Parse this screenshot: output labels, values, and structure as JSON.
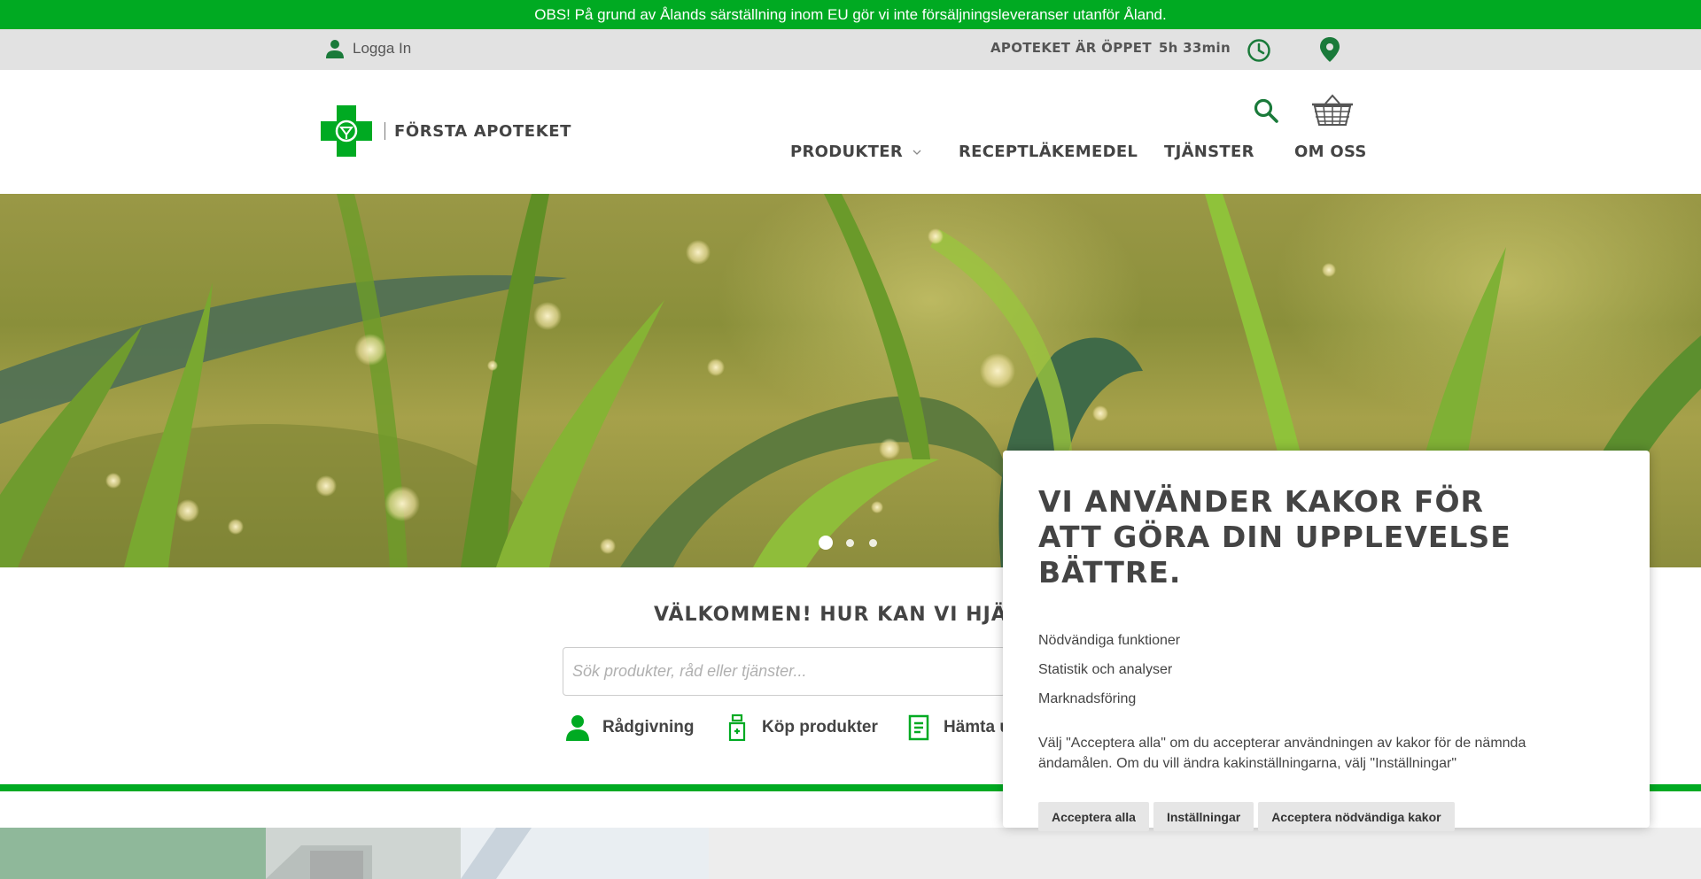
{
  "notice": {
    "text": "OBS! På grund av Ålands särställning inom EU gör vi inte försäljningsleveranser utanför Åland."
  },
  "topbar": {
    "login_label": "Logga In",
    "status_label": "APOTEKET ÄR ÖPPET",
    "status_time": "5h 33min",
    "icons": [
      "user-icon",
      "clock-icon",
      "location-pin-icon"
    ]
  },
  "header": {
    "logo_text": "FÖRSTA APOTEKET",
    "icons": [
      "search-icon",
      "basket-icon"
    ],
    "nav": [
      {
        "label": "PRODUKTER",
        "has_dropdown": true
      },
      {
        "label": "RECEPTLÄKEMEDEL"
      },
      {
        "label": "TJÄNSTER"
      },
      {
        "label": "OM OSS"
      }
    ]
  },
  "hero": {
    "slides": 3,
    "active_slide": 1
  },
  "welcome": {
    "title": "VÄLKOMMEN! HUR KAN VI HJÄLPA",
    "search_placeholder": "Sök produkter, råd eller tjänster...",
    "quick_links": [
      {
        "label": "Rådgivning",
        "icon": "person-icon"
      },
      {
        "label": "Köp produkter",
        "icon": "medicine-bottle-icon"
      },
      {
        "label": "Hämta u",
        "icon": "prescription-icon"
      }
    ]
  },
  "cookie": {
    "title": "VI ANVÄNDER KAKOR FÖR ATT GÖRA DIN UPPLEVELSE BÄTTRE.",
    "categories": [
      "Nödvändiga funktioner",
      "Statistik och analyser",
      "Marknadsföring"
    ],
    "description": "Välj \"Acceptera alla\" om du accepterar användningen av kakor för de nämnda ändamålen. Om du vill ändra kakinställningarna, välj \"Inställningar\"",
    "buttons": [
      "Acceptera alla",
      "Inställningar",
      "Acceptera nödvändiga kakor"
    ]
  },
  "colors": {
    "brand_green": "#00aa22",
    "dark_green": "#1a7a3a",
    "topbar_gray": "#e2e2e2"
  }
}
